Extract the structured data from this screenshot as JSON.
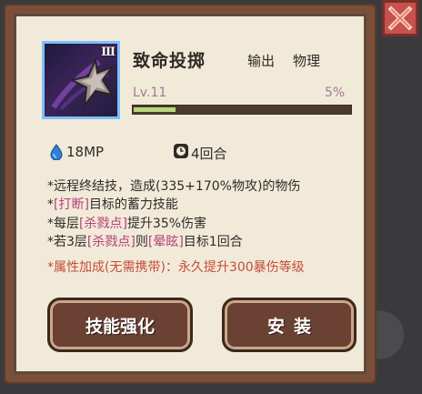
{
  "skill": {
    "name": "致命投掷",
    "rank": "Ⅲ",
    "icon": "thrown-star-icon",
    "tags": [
      "输出",
      "物理"
    ],
    "level": "Lv.11",
    "progress_text": "5%",
    "progress": 0.05
  },
  "stats": {
    "mp_icon": "water-drop-icon",
    "mp": "18MP",
    "turns_icon": "clock-icon",
    "turns": "4回合"
  },
  "description": [
    {
      "prefix": "*远程终结技，造成(335+170%物攻)的物伤"
    },
    {
      "prefix": "*",
      "hl": "[打断]",
      "suffix": "目标的蓄力技能"
    },
    {
      "prefix": "*每层",
      "hl": "[杀戮点]",
      "suffix": "提升35%伤害"
    },
    {
      "prefix": "*若3层",
      "hl": "[杀戮点]",
      "mid": "则",
      "hl2": "[晕眩]",
      "suffix": "目标1回合"
    }
  ],
  "attribute_note": "*属性加成(无需携带)：永久提升300暴伤等级",
  "buttons": {
    "upgrade": "技能强化",
    "install": "安装"
  },
  "colors": {
    "frame": "#7a4f3a",
    "panel": "#f2ead9",
    "highlight": "#b4427a",
    "note": "#c44c3a",
    "close": "#c9514c",
    "progress": "#b7d67a"
  }
}
